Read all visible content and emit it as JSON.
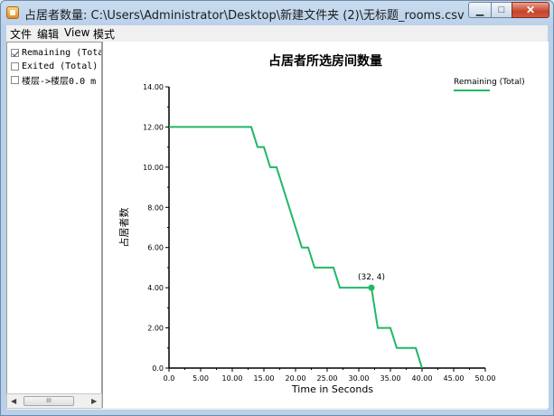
{
  "window": {
    "title": "占居者数量: C:\\Users\\Administrator\\Desktop\\新建文件夹 (2)\\无标题_rooms.csv",
    "minimize_glyph": "▁",
    "maximize_glyph": "□",
    "close_glyph": "✕"
  },
  "menu": [
    "文件",
    "编辑",
    "View",
    "模式"
  ],
  "series_list": [
    {
      "label": "Remaining (Total)",
      "checked": true
    },
    {
      "label": "Exited (Total)",
      "checked": false
    },
    {
      "label": "楼层->楼层0.0 m",
      "checked": false
    }
  ],
  "scrollbar": {
    "left_arrow": "◀",
    "right_arrow": "▶",
    "thumb_grip": "III"
  },
  "chart_data": {
    "type": "line",
    "title": "占居者所选房间数量",
    "xlabel": "Time in Seconds",
    "ylabel": "占居者数",
    "xlim": [
      0,
      50
    ],
    "ylim": [
      0,
      14
    ],
    "x_ticks": [
      "0.0",
      "5.00",
      "10.00",
      "15.00",
      "20.00",
      "25.00",
      "30.00",
      "35.00",
      "40.00",
      "45.00",
      "50.00"
    ],
    "y_ticks": [
      "0.0",
      "2.00",
      "4.00",
      "6.00",
      "8.00",
      "10.00",
      "12.00",
      "14.00"
    ],
    "legend_position": "top-right",
    "color": "#1fb866",
    "series": [
      {
        "name": "Remaining (Total)",
        "x": [
          0,
          13,
          14,
          15,
          16,
          17,
          21,
          22,
          23,
          24,
          26,
          27,
          32,
          33,
          34,
          35,
          36,
          37,
          39,
          40
        ],
        "y": [
          12,
          12,
          11,
          11,
          10,
          10,
          6,
          6,
          5,
          5,
          5,
          4,
          4,
          2,
          2,
          2,
          1,
          1,
          1,
          0
        ]
      }
    ],
    "annotation": {
      "x": 32,
      "y": 4,
      "label": "(32, 4)"
    }
  }
}
